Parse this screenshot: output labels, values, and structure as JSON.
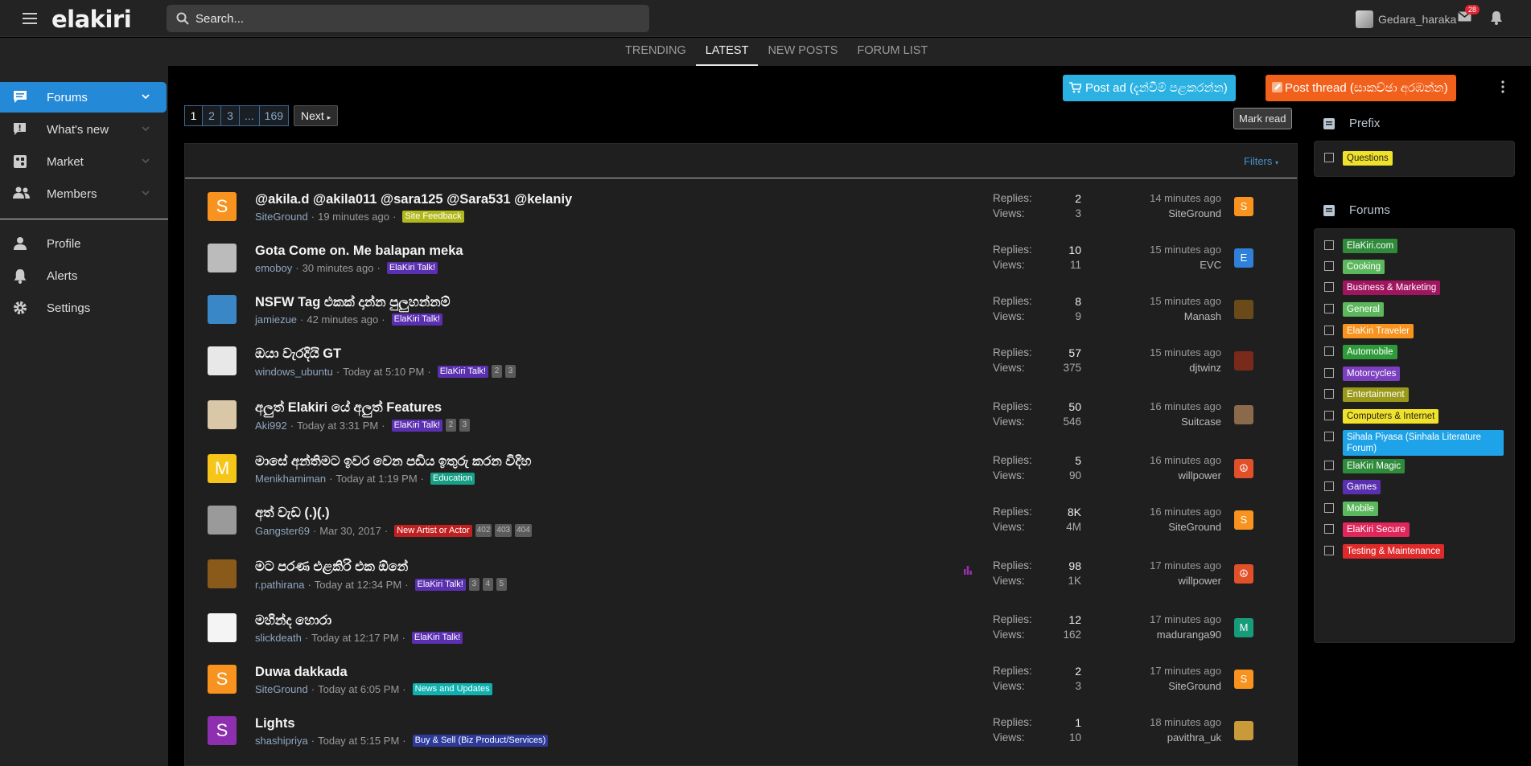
{
  "header": {
    "logo": "elakiri",
    "search_placeholder": "Search...",
    "username": "Gedara_haraka",
    "mail_count": "28"
  },
  "nav": {
    "tabs": [
      {
        "label": "TRENDING"
      },
      {
        "label": "LATEST"
      },
      {
        "label": "NEW POSTS"
      },
      {
        "label": "FORUM LIST"
      }
    ]
  },
  "sidebar": {
    "items": [
      {
        "label": "Forums"
      },
      {
        "label": "What's new"
      },
      {
        "label": "Market"
      },
      {
        "label": "Members"
      },
      {
        "label": "Profile"
      },
      {
        "label": "Alerts"
      },
      {
        "label": "Settings"
      }
    ]
  },
  "actions": {
    "post_ad": "Post ad (දැන්වීම් පළකරන්න)",
    "post_thread": "Post thread (සාකච්ඡා අරඹන්න)",
    "mark_read": "Mark read",
    "filters": "Filters"
  },
  "pager": {
    "pages": [
      "1",
      "2",
      "3",
      "...",
      "169"
    ],
    "next": "Next"
  },
  "labels": {
    "replies": "Replies:",
    "views": "Views:"
  },
  "threads": [
    {
      "title": "@akila.d @akila011 @sara125 @Sara531 @kelaniy",
      "author": "SiteGround",
      "time": "19 minutes ago",
      "tag": "Site Feedback",
      "tag_color": "#b0b81c",
      "pages": [],
      "replies": "2",
      "views": "3",
      "last_time": "14 minutes ago",
      "last_user": "SiteGround",
      "avatar_letter": "S",
      "avatar_color": "#f7931e",
      "last_letter": "S",
      "last_color": "#f7931e"
    },
    {
      "title": "Gota Come on. Me balapan meka",
      "author": "emoboy",
      "time": "30 minutes ago",
      "tag": "ElaKiri Talk!",
      "tag_color": "#5a2fb0",
      "pages": [],
      "replies": "10",
      "views": "11",
      "last_time": "15 minutes ago",
      "last_user": "EVC",
      "avatar_letter": "",
      "avatar_color": "#bbbbbb",
      "last_letter": "E",
      "last_color": "#2f80d8"
    },
    {
      "title": "NSFW Tag එකක් දාන්න පුලුහන්නම්",
      "author": "jamiezue",
      "time": "42 minutes ago",
      "tag": "ElaKiri Talk!",
      "tag_color": "#5a2fb0",
      "pages": [],
      "replies": "8",
      "views": "9",
      "last_time": "15 minutes ago",
      "last_user": "Manash",
      "avatar_letter": "",
      "avatar_color": "#3a87c8",
      "last_letter": "",
      "last_color": "#6b4a1a"
    },
    {
      "title": "ඔයා වැරදියි GT",
      "author": "windows_ubuntu",
      "time": "Today at 5:10 PM",
      "tag": "ElaKiri Talk!",
      "tag_color": "#5a2fb0",
      "pages": [
        "2",
        "3"
      ],
      "replies": "57",
      "views": "375",
      "last_time": "15 minutes ago",
      "last_user": "djtwinz",
      "avatar_letter": "",
      "avatar_color": "#e8e8e8",
      "last_letter": "",
      "last_color": "#7a2a1a"
    },
    {
      "title": "අලුත් Elakiri යේ අලුත් Features",
      "author": "Aki992",
      "time": "Today at 3:31 PM",
      "tag": "ElaKiri Talk!",
      "tag_color": "#5a2fb0",
      "pages": [
        "2",
        "3"
      ],
      "replies": "50",
      "views": "546",
      "last_time": "16 minutes ago",
      "last_user": "Suitcase",
      "avatar_letter": "",
      "avatar_color": "#d9c7a8",
      "last_letter": "",
      "last_color": "#8a6a4a"
    },
    {
      "title": "මාසේ අන්තිමට ඉවර වෙන පඩිය ඉතුරු කරන විදිහ",
      "author": "Menikhamiman",
      "time": "Today at 1:19 PM",
      "tag": "Education",
      "tag_color": "#16a085",
      "pages": [],
      "replies": "5",
      "views": "90",
      "last_time": "16 minutes ago",
      "last_user": "willpower",
      "avatar_letter": "M",
      "avatar_color": "#f5c518",
      "last_letter": "☮",
      "last_color": "#e2502a"
    },
    {
      "title": "අත් වැඩ (.)(.)",
      "author": "Gangster69",
      "time": "Mar 30, 2017",
      "tag": "New Artist or Actor",
      "tag_color": "#c0201f",
      "pages": [
        "402",
        "403",
        "404"
      ],
      "replies": "8K",
      "views": "4M",
      "last_time": "16 minutes ago",
      "last_user": "SiteGround",
      "avatar_letter": "",
      "avatar_color": "#9a9a9a",
      "last_letter": "S",
      "last_color": "#f7931e"
    },
    {
      "title": "මට පරණ එළකිරි එක ඕනේ",
      "author": "r.pathirana",
      "time": "Today at 12:34 PM",
      "tag": "ElaKiri Talk!",
      "tag_color": "#5a2fb0",
      "pages": [
        "3",
        "4",
        "5"
      ],
      "replies": "98",
      "views": "1K",
      "last_time": "17 minutes ago",
      "last_user": "willpower",
      "avatar_letter": "",
      "avatar_color": "#8a5a1a",
      "last_letter": "☮",
      "last_color": "#e2502a",
      "poll": true
    },
    {
      "title": "මහින්ද හොරා",
      "author": "slickdeath",
      "time": "Today at 12:17 PM",
      "tag": "ElaKiri Talk!",
      "tag_color": "#5a2fb0",
      "pages": [],
      "replies": "12",
      "views": "162",
      "last_time": "17 minutes ago",
      "last_user": "maduranga90",
      "avatar_letter": "",
      "avatar_color": "#f4f4f4",
      "last_letter": "M",
      "last_color": "#179c7a"
    },
    {
      "title": "Duwa dakkada",
      "author": "SiteGround",
      "time": "Today at 6:05 PM",
      "tag": "News and Updates",
      "tag_color": "#0fb0b0",
      "pages": [],
      "replies": "2",
      "views": "3",
      "last_time": "17 minutes ago",
      "last_user": "SiteGround",
      "avatar_letter": "S",
      "avatar_color": "#f7931e",
      "last_letter": "S",
      "last_color": "#f7931e"
    },
    {
      "title": "Lights",
      "author": "shashipriya",
      "time": "Today at 5:15 PM",
      "tag": "Buy & Sell (Biz Product/Services)",
      "tag_color": "#2d3a9a",
      "pages": [],
      "replies": "1",
      "views": "10",
      "last_time": "18 minutes ago",
      "last_user": "pavithra_uk",
      "avatar_letter": "S",
      "avatar_color": "#8e2fb0",
      "last_letter": "",
      "last_color": "#c89a3a"
    }
  ],
  "right": {
    "prefix_title": "Prefix",
    "prefixes": [
      {
        "label": "Questions",
        "color": "#f0e12a",
        "text": "#222222"
      }
    ],
    "forums_title": "Forums",
    "forums": [
      {
        "label": "ElaKiri.com",
        "color": "#2e8b3a",
        "text": "#ffffff"
      },
      {
        "label": "Cooking",
        "color": "#5cb85c",
        "text": "#ffffff"
      },
      {
        "label": "Business & Marketing",
        "color": "#a0155f",
        "text": "#ffffff"
      },
      {
        "label": "General",
        "color": "#5cb85c",
        "text": "#ffffff"
      },
      {
        "label": "ElaKiri Traveler",
        "color": "#f7931e",
        "text": "#ffffff"
      },
      {
        "label": "Automobile",
        "color": "#2e9b3a",
        "text": "#ffffff"
      },
      {
        "label": "Motorcycles",
        "color": "#7b3fbf",
        "text": "#ffffff"
      },
      {
        "label": "Entertainment",
        "color": "#9a9a1a",
        "text": "#ffffff"
      },
      {
        "label": "Computers & Internet",
        "color": "#f0e12a",
        "text": "#222222"
      },
      {
        "label": "Sihala Piyasa (Sinhala Literature Forum)",
        "color": "#1fa3e8",
        "text": "#ffffff"
      },
      {
        "label": "ElaKiri Magic",
        "color": "#2e8b3a",
        "text": "#ffffff"
      },
      {
        "label": "Games",
        "color": "#5a2fb0",
        "text": "#ffffff"
      },
      {
        "label": "Mobile",
        "color": "#5cb85c",
        "text": "#ffffff"
      },
      {
        "label": "ElaKiri Secure",
        "color": "#e0265a",
        "text": "#ffffff"
      },
      {
        "label": "Testing & Maintenance",
        "color": "#e02a2a",
        "text": "#ffffff"
      }
    ]
  }
}
